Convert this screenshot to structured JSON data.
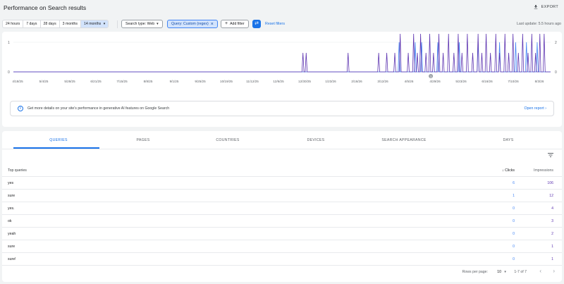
{
  "header": {
    "title": "Performance on Search results",
    "export_label": "EXPORT"
  },
  "filters": {
    "ranges": [
      "24 hours",
      "7 days",
      "28 days",
      "3 months",
      "14 months"
    ],
    "active_range": "14 months",
    "search_type": "Search type: Web",
    "query_filter": "Query: Custom (regex)",
    "add_filter": "Add filter",
    "reset": "Reset filters",
    "last_update": "Last update: 5.5 hours ago"
  },
  "chart_data": {
    "type": "line",
    "y_left_ticks": [
      "1",
      "0"
    ],
    "y_right_ticks": [
      "2",
      "0"
    ],
    "x_tick_labels": [
      "4/18/25",
      "5/4/25",
      "5/28/25",
      "6/21/25",
      "7/15/25",
      "8/8/25",
      "9/1/25",
      "9/25/25",
      "10/19/25",
      "11/12/25",
      "12/6/25",
      "12/30/25",
      "1/23/26",
      "2/16/26",
      "3/12/26",
      "4/5/26",
      "4/29/26",
      "5/23/26",
      "6/16/26",
      "7/10/26",
      "8/3/26"
    ],
    "annotation": "1",
    "series": [
      {
        "color": "#4285f4",
        "spikes": [
          [
            0.718,
            1
          ],
          [
            0.748,
            1
          ],
          [
            0.76,
            1
          ],
          [
            0.79,
            1
          ],
          [
            0.83,
            1
          ],
          [
            0.865,
            1
          ],
          [
            0.905,
            1
          ],
          [
            0.935,
            1
          ],
          [
            0.955,
            1
          ],
          [
            0.975,
            1
          ]
        ]
      },
      {
        "color": "#5e35b1",
        "spikes": [
          [
            0.539,
            1
          ],
          [
            0.545,
            1
          ],
          [
            0.623,
            1
          ],
          [
            0.68,
            1
          ],
          [
            0.695,
            1
          ],
          [
            0.71,
            1
          ],
          [
            0.72,
            2
          ],
          [
            0.735,
            1
          ],
          [
            0.745,
            2
          ],
          [
            0.752,
            1
          ],
          [
            0.758,
            2
          ],
          [
            0.768,
            1
          ],
          [
            0.775,
            2
          ],
          [
            0.782,
            1
          ],
          [
            0.792,
            2
          ],
          [
            0.8,
            1
          ],
          [
            0.81,
            2
          ],
          [
            0.82,
            1
          ],
          [
            0.828,
            2
          ],
          [
            0.835,
            1
          ],
          [
            0.845,
            2
          ],
          [
            0.855,
            1
          ],
          [
            0.865,
            2
          ],
          [
            0.872,
            1
          ],
          [
            0.88,
            2
          ],
          [
            0.888,
            1
          ],
          [
            0.898,
            2
          ],
          [
            0.905,
            1
          ],
          [
            0.915,
            2
          ],
          [
            0.922,
            1
          ],
          [
            0.93,
            2
          ],
          [
            0.94,
            1
          ],
          [
            0.948,
            2
          ],
          [
            0.958,
            1
          ],
          [
            0.965,
            2
          ],
          [
            0.972,
            1
          ],
          [
            0.98,
            2
          ],
          [
            0.988,
            2
          ]
        ]
      }
    ]
  },
  "info": {
    "text": "Get more details on your site's performance in generative AI features on Google Search",
    "link": "Open report"
  },
  "tabs": [
    "QUERIES",
    "PAGES",
    "COUNTRIES",
    "DEVICES",
    "SEARCH APPEARANCE",
    "DAYS"
  ],
  "table": {
    "col_queries": "Top queries",
    "col_clicks": "Clicks",
    "col_impressions": "Impressions",
    "rows": [
      {
        "q": "yes",
        "c": "6",
        "i": "106"
      },
      {
        "q": "sure",
        "c": "1",
        "i": "12"
      },
      {
        "q": "yes.",
        "c": "0",
        "i": "4"
      },
      {
        "q": "ok",
        "c": "0",
        "i": "3"
      },
      {
        "q": "yeah",
        "c": "0",
        "i": "2"
      },
      {
        "q": "sure",
        "c": "0",
        "i": "1"
      },
      {
        "q": "sure!",
        "c": "0",
        "i": "1"
      }
    ]
  },
  "pager": {
    "label": "Rows per page:",
    "value": "10",
    "range": "1-7 of 7"
  }
}
